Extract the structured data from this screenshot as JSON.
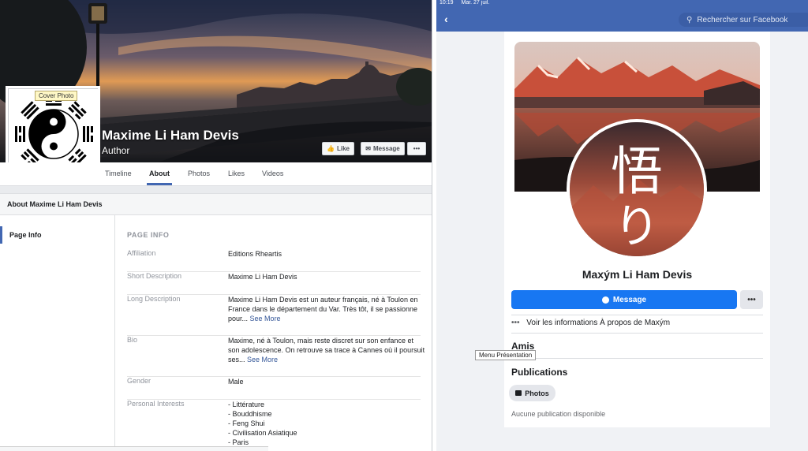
{
  "desktop": {
    "cover_tooltip": "Cover Photo",
    "page_name": "Maxime Li Ham Devis",
    "page_category": "Author",
    "buttons": {
      "like": "Like",
      "message": "Message",
      "more": "•••"
    },
    "tabs": [
      "Timeline",
      "About",
      "Photos",
      "Likes",
      "Videos"
    ],
    "about_header": "About Maxime Li Ham Devis",
    "sidebar_item": "Page Info",
    "section_title": "PAGE INFO",
    "rows": [
      {
        "label": "Affiliation",
        "value": "Editions Rheartis"
      },
      {
        "label": "Short Description",
        "value": "Maxime Li Ham Devis"
      },
      {
        "label": "Long Description",
        "value": "Maxime Li Ham Devis est un auteur français, né à Toulon en France dans le département du Var. Très tôt, il se passionne pour...",
        "link": "See More"
      },
      {
        "label": "Bio",
        "value": "Maxime, né à Toulon, mais reste discret sur son enfance et son adolescence. On retrouve sa trace à Cannes où il poursuit ses...",
        "link": "See More"
      },
      {
        "label": "Gender",
        "value": "Male"
      },
      {
        "label": "Personal Interests",
        "value": "- Littérature\n- Bouddhisme\n- Feng Shui\n- Civilisation Asiatique\n- Paris"
      }
    ]
  },
  "mobile": {
    "status_time": "10:19",
    "status_date": "Mar. 27 juil.",
    "search_placeholder": "Rechercher sur Facebook",
    "avatar_kanji_1": "悟",
    "avatar_kanji_2": "り",
    "profile_name": "Maxým Li Ham Devis",
    "message_button": "Message",
    "more_button": "•••",
    "about_link_dots": "•••",
    "about_link": "Voir les informations À propos de Maxým",
    "friends_title": "Amis",
    "tooltip": "Menu Présentation",
    "publications_title": "Publications",
    "photos_button": "Photos",
    "empty_text": "Aucune publication disponible"
  },
  "colors": {
    "fb_blue": "#4267b2",
    "messenger_blue": "#1877f2",
    "link_blue": "#365899"
  }
}
